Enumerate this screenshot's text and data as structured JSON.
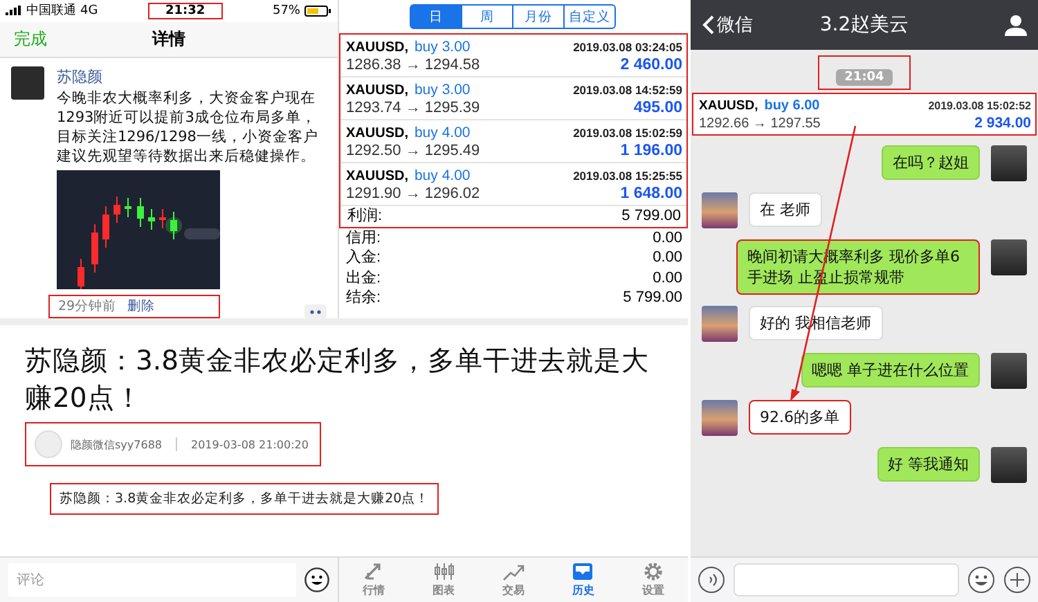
{
  "status_bar": {
    "carrier": "中国联通",
    "network": "4G",
    "time": "21:32",
    "time_highlighted": true,
    "battery": "57%"
  },
  "post_nav": {
    "done": "完成",
    "title": "详情"
  },
  "post": {
    "author": "苏隐颜",
    "text": "今晚非农大概率利多，大资金客户现在1293附近可以提前3成仓位布局多单，目标关注1296/1298一线，小资金客户建议先观望等待数据出来后稳健操作。",
    "time_ago": "29分钟前",
    "delete": "删除",
    "footer_highlighted": true
  },
  "history": {
    "periods": [
      {
        "label": "日",
        "selected": true
      },
      {
        "label": "周",
        "selected": false
      },
      {
        "label": "月份",
        "selected": false
      },
      {
        "label": "自定义",
        "selected": false
      }
    ],
    "trades": [
      {
        "symbol": "XAUUSD,",
        "side": "buy 3.00",
        "time": "2019.03.08 03:24:05",
        "prices": "1286.38 → 1294.58",
        "profit": "2 460.00"
      },
      {
        "symbol": "XAUUSD,",
        "side": "buy 3.00",
        "time": "2019.03.08 14:52:59",
        "prices": "1293.74 → 1295.39",
        "profit": "495.00"
      },
      {
        "symbol": "XAUUSD,",
        "side": "buy 4.00",
        "time": "2019.03.08 15:02:59",
        "prices": "1292.50 → 1295.49",
        "profit": "1 196.00"
      },
      {
        "symbol": "XAUUSD,",
        "side": "buy 4.00",
        "time": "2019.03.08 15:25:55",
        "prices": "1291.90 → 1296.02",
        "profit": "1 648.00"
      }
    ],
    "trades_highlighted": true,
    "total": {
      "label": "利润:",
      "value": "5 799.00"
    },
    "summary": [
      {
        "label": "信用:",
        "value": "0.00"
      },
      {
        "label": "入金:",
        "value": "0.00"
      },
      {
        "label": "出金:",
        "value": "0.00"
      },
      {
        "label": "结余:",
        "value": "5 799.00"
      }
    ]
  },
  "article": {
    "title": "苏隐颜：3.8黄金非农必定利多，多单干进去就是大赚20点！",
    "author": "隐颜微信syy7688",
    "date": "2019-03-08 21:00:20",
    "meta_highlighted": true,
    "quote": "苏隐颜：3.8黄金非农必定利多，多单干进去就是大赚20点！",
    "quote_highlighted": true
  },
  "comment_bar": {
    "placeholder": "评论"
  },
  "tab_bar": {
    "tabs": [
      {
        "label": "行情",
        "kind": "quotes",
        "selected": false
      },
      {
        "label": "图表",
        "kind": "chart",
        "selected": false
      },
      {
        "label": "交易",
        "kind": "trade",
        "selected": false
      },
      {
        "label": "历史",
        "kind": "history",
        "selected": true
      },
      {
        "label": "设置",
        "kind": "settings",
        "selected": false
      }
    ]
  },
  "chat": {
    "back": "微信",
    "title": "3.2赵美云",
    "time": "21:04",
    "time_highlighted": true,
    "trade_card": {
      "symbol": "XAUUSD,",
      "side": "buy 6.00",
      "time": "2019.03.08 15:02:52",
      "prices": "1292.66 → 1297.55",
      "profit": "2 934.00",
      "highlighted": true
    },
    "messages": [
      {
        "kind": "outgoing",
        "text": "在吗？赵姐",
        "highlighted": false
      },
      {
        "kind": "incoming",
        "text": "在 老师",
        "highlighted": false
      },
      {
        "kind": "outgoing",
        "text": "晚间初请大概率利多 现价多单6手进场 止盈止损常规带",
        "highlighted": true
      },
      {
        "kind": "incoming",
        "text": "好的 我相信老师",
        "highlighted": false
      },
      {
        "kind": "outgoing",
        "text": "嗯嗯 单子进在什么位置",
        "highlighted": false
      },
      {
        "kind": "incoming",
        "text": "92.6的多单",
        "highlighted": true
      },
      {
        "kind": "outgoing",
        "text": "好 等我通知",
        "highlighted": false
      }
    ],
    "annotation_arrow": true
  }
}
